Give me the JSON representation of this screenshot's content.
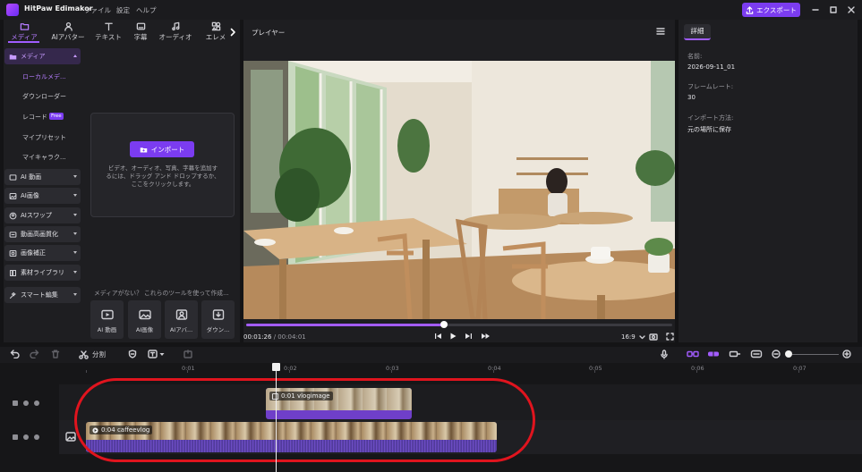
{
  "app": {
    "name": "HitPaw Edimakor",
    "menus": [
      "ファイル",
      "設定",
      "ヘルプ"
    ],
    "export_label": "エクスポート",
    "accent": "#7b3cf0"
  },
  "categories": [
    {
      "label": "メディア",
      "icon": "media-icon"
    },
    {
      "label": "AIアバター",
      "icon": "avatar-icon"
    },
    {
      "label": "テキスト",
      "icon": "text-icon"
    },
    {
      "label": "字幕",
      "icon": "subtitle-icon"
    },
    {
      "label": "オーディオ",
      "icon": "music-icon"
    },
    {
      "label": "エレメ",
      "icon": "element-icon"
    }
  ],
  "sidebar": {
    "media_head": "メディア",
    "media_items": [
      "ローカルメデ...",
      "ダウンローダー",
      "レコード",
      "マイプリセット",
      "マイキャラク..."
    ],
    "record_badge": "Free",
    "groups": [
      "AI 動画",
      "AI画像",
      "AIスワップ",
      "動画高画質化",
      "画像補正",
      "素材ライブラリ",
      "スマート編集"
    ]
  },
  "import": {
    "button": "インポート",
    "hint": "ビデオ、オーディオ、写真、字幕を追加するには、ドラッグ アンド ドロップするか、ここをクリックします。"
  },
  "tools": {
    "prompt": "メディアがない？ これらのツールを使って作成...",
    "items": [
      "AI 動画",
      "AI画像",
      "AIアバ...",
      "ダウン..."
    ]
  },
  "player": {
    "title": "プレイヤー",
    "current_time": "00:01:26",
    "total_time": "00:04:01",
    "progress": 0.465,
    "ratio": "16:9"
  },
  "details": {
    "tab": "詳細",
    "fields": [
      {
        "label": "名前:",
        "value": "2026-09-11_01"
      },
      {
        "label": "フレームレート:",
        "value": "30"
      },
      {
        "label": "インポート方法:",
        "value": "元の場所に保存"
      }
    ]
  },
  "timeline": {
    "split_label": "分割",
    "ruler": [
      "0:01",
      "0:02",
      "0:03",
      "0:04",
      "0:05",
      "0:06",
      "0:07"
    ],
    "clips": [
      {
        "label": "0:01 vlogimage"
      },
      {
        "label": "0:04 caffeevlog"
      }
    ]
  }
}
